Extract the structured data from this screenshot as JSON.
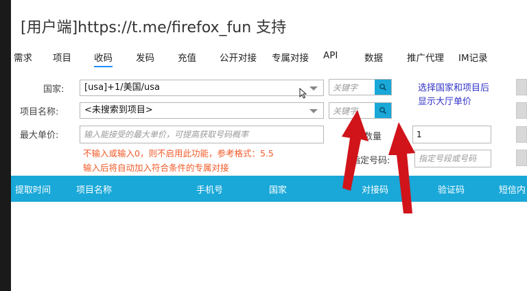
{
  "title": "[用户端]https://t.me/firefox_fun 支持",
  "menu": [
    "需求",
    "项目",
    "收码",
    "发码",
    "充值",
    "公开对接",
    "专属对接",
    "API",
    "数据",
    "推广代理",
    "IM记录"
  ],
  "active_menu": "收码",
  "form": {
    "country_label": "国家:",
    "country_value": "[usa]+1/美国/usa",
    "project_label": "项目名称:",
    "project_value": "<未搜索到项目>",
    "max_price_label": "最大单价:",
    "max_price_placeholder": "输入能接受的最大单价，可提高获取号码概率",
    "search_placeholder": "关键字",
    "hint_line1": "选择国家和项目后",
    "hint_line2": "显示大厅单价",
    "quantity_label": "取数量",
    "quantity_value": "1",
    "assign_label": "指定号码:",
    "assign_placeholder": "指定号段或号码",
    "note_line1": "不输入或输入0，则不启用此功能，参考格式：5.5",
    "note_line2": "输入后将自动加入符合条件的专属对接"
  },
  "table": {
    "columns": [
      "提取时间",
      "项目名称",
      "手机号",
      "国家",
      "对接码",
      "验证码",
      "短信内"
    ]
  },
  "colors": {
    "accent": "#19a8d8",
    "note": "#f05a28",
    "hint": "#3232c8",
    "arrow": "#d0141a"
  },
  "icons": [
    "search-icon",
    "chevron-down-icon",
    "cursor-icon",
    "red-arrow-annotation"
  ]
}
